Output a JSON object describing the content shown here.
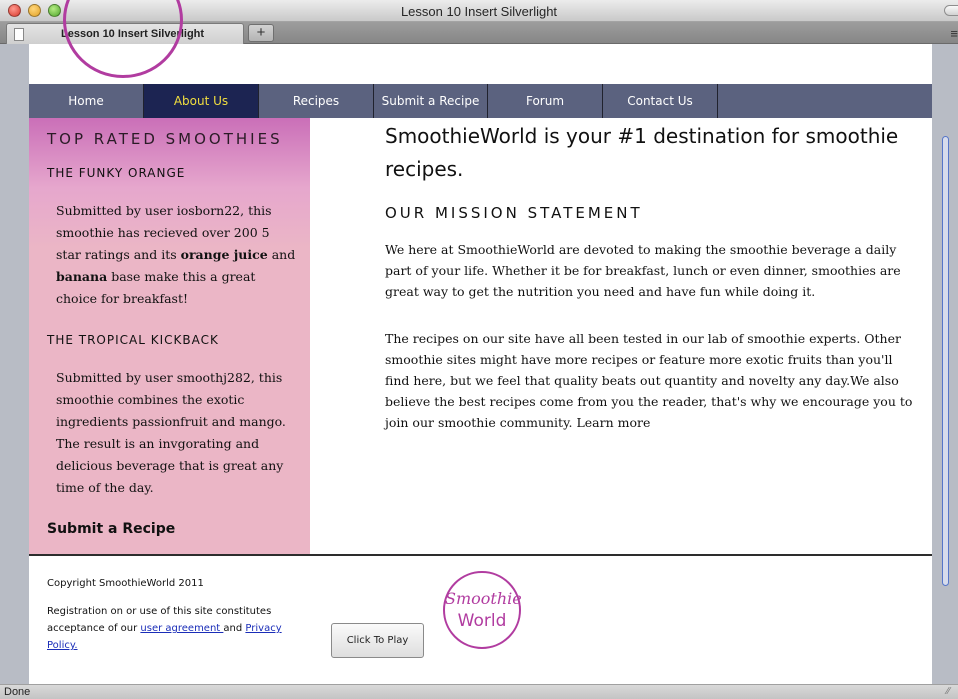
{
  "window": {
    "title": "Lesson 10 Insert Silverlight",
    "tab_title": "Lesson 10 Insert Silverlight",
    "new_tab_label": "+",
    "status": "Done"
  },
  "nav": {
    "items": [
      {
        "label": "Home",
        "active": false
      },
      {
        "label": "About Us",
        "active": true
      },
      {
        "label": "Recipes",
        "active": false
      },
      {
        "label": "Submit a Recipe",
        "active": false
      },
      {
        "label": "Forum",
        "active": false
      },
      {
        "label": "Contact Us",
        "active": false
      }
    ],
    "active_text_color": "#f2df3f",
    "active_bg": "#1c2452",
    "bar_bg": "#5b627f"
  },
  "sidebar": {
    "heading": "TOP RATED SMOOTHIES",
    "items": [
      {
        "title": "THE FUNKY ORANGE",
        "desc_1": "Submitted by user iosborn22, this smoothie has recieved over 200 5 star ratings and its ",
        "bold_1": "orange juice",
        "desc_2": " and ",
        "bold_2": "banana",
        "desc_3": " base make this a great choice for breakfast!"
      },
      {
        "title": "THE TROPICAL KICKBACK",
        "desc": "Submitted by user smoothj282, this smoothie combines the exotic ingredients passionfruit and mango. The result is an invgorating and delicious beverage that is great any time of the day."
      }
    ],
    "submit_link": "Submit a Recipe"
  },
  "main": {
    "heading": "SmoothieWorld is your #1 destination for smoothie recipes.",
    "mission_title": "OUR MISSION STATEMENT",
    "paragraph_1": "We here at SmoothieWorld are devoted to making the smoothie beverage a daily part of your life. Whether it be for breakfast, lunch or even dinner, smoothies are great way to get the nutrition you need and have fun while doing it.",
    "paragraph_2": "The recipes on our site have all been tested in our lab of smoothie experts. Other smoothie sites might have more recipes or feature more exotic fruits than you'll find here, but we feel that quality beats out quantity and novelty any day.We also believe the best recipes come from you the reader, that's why we encourage you to join our smoothie community.",
    "learn_more": "Learn more"
  },
  "footer": {
    "copyright": "Copyright SmoothieWorld 2011",
    "legal_prefix": "Registration on or use of this site constitutes acceptance of our ",
    "user_agreement_link": "user agreement ",
    "legal_and": "and ",
    "privacy_link": "Privacy Policy.",
    "play_button": "Click To Play",
    "logo_line1": "Smoothie",
    "logo_line2": "World"
  },
  "colors": {
    "brand_magenta": "#b13ca0",
    "sidebar_pink": "#ebb6c6",
    "link_blue": "#1a2db8"
  }
}
